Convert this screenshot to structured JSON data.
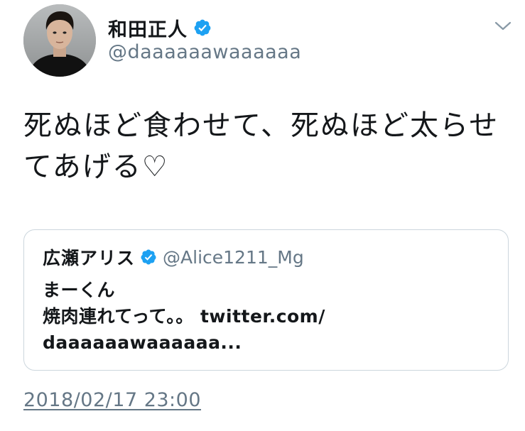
{
  "author": {
    "display_name": "和田正人",
    "handle": "@daaaaaawaaaaaa",
    "verified": true,
    "avatar": "profile-photo"
  },
  "menu": {
    "icon": "chevron-down-icon"
  },
  "tweet": {
    "text": "死ぬほど食わせて、死ぬほど太らせてあげる♡",
    "timestamp": "2018/02/17 23:00"
  },
  "quoted_tweet": {
    "display_name": "広瀬アリス",
    "handle": "@Alice1211_Mg",
    "verified": true,
    "lines": [
      "まーくん",
      "焼肉連れてって。。 twitter.com/",
      "daaaaaawaaaaaa..."
    ]
  },
  "colors": {
    "text": "#14171a",
    "secondary": "#657786",
    "verified_badge": "#1da1f2",
    "border": "#ccd6dd"
  }
}
